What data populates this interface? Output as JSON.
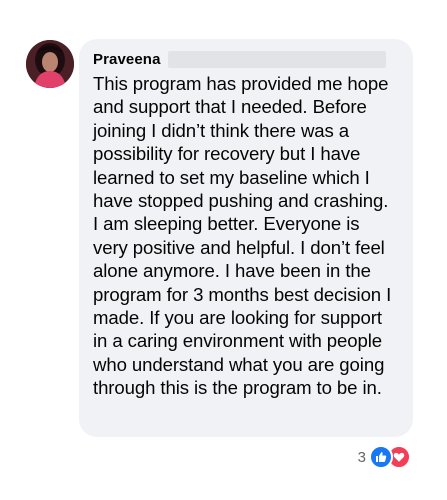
{
  "comment": {
    "author": "Praveena",
    "lines": [
      "This program has provided me hope",
      "and support that I needed.  Before",
      "joining I didn’t think there was a",
      "possibility for recovery but I have",
      "learned to set my baseline which I",
      "have stopped pushing and crashing.",
      "I am sleeping better.  Everyone is",
      "very positive and helpful.  I don’t feel",
      "alone anymore. I have been in the",
      "program for 3 months best decision I",
      "made.  If you are looking for support",
      "in a caring environment with people",
      "who understand what you are going",
      "through this is the program to be in."
    ]
  },
  "reactions": {
    "count": "3",
    "icons": [
      "like-icon",
      "love-icon"
    ],
    "like_color": "#1877f2",
    "love_color": "#f33e58"
  },
  "colors": {
    "bubble_background": "#f0f2f5",
    "text": "#050505",
    "muted": "#65676b"
  }
}
